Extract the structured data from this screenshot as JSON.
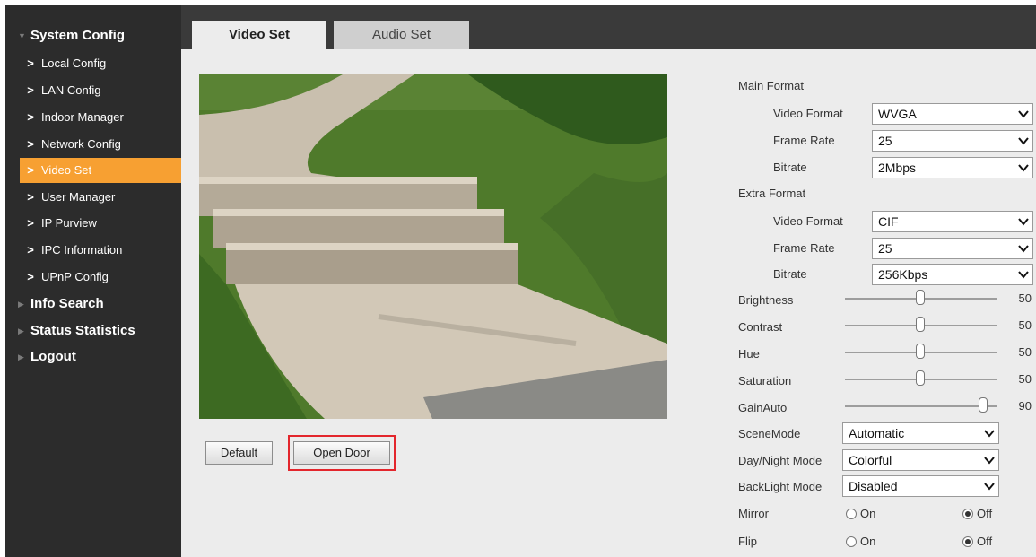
{
  "sidebar": {
    "system_config": "System Config",
    "items": [
      {
        "label": "Local Config"
      },
      {
        "label": "LAN Config"
      },
      {
        "label": "Indoor Manager"
      },
      {
        "label": "Network Config"
      },
      {
        "label": "Video Set",
        "active": true
      },
      {
        "label": "User Manager"
      },
      {
        "label": "IP Purview"
      },
      {
        "label": "IPC Information"
      },
      {
        "label": "UPnP Config"
      }
    ],
    "info_search": "Info Search",
    "status_statistics": "Status Statistics",
    "logout": "Logout"
  },
  "tabs": {
    "video_set": "Video Set",
    "audio_set": "Audio Set"
  },
  "buttons": {
    "default": "Default",
    "open_door": "Open Door"
  },
  "settings": {
    "main_format": "Main Format",
    "extra_format": "Extra Format",
    "main": {
      "video_format": {
        "label": "Video Format",
        "value": "WVGA"
      },
      "frame_rate": {
        "label": "Frame Rate",
        "value": "25"
      },
      "bitrate": {
        "label": "Bitrate",
        "value": "2Mbps"
      }
    },
    "extra": {
      "video_format": {
        "label": "Video Format",
        "value": "CIF"
      },
      "frame_rate": {
        "label": "Frame Rate",
        "value": "25"
      },
      "bitrate": {
        "label": "Bitrate",
        "value": "256Kbps"
      }
    },
    "sliders": {
      "brightness": {
        "label": "Brightness",
        "value": "50"
      },
      "contrast": {
        "label": "Contrast",
        "value": "50"
      },
      "hue": {
        "label": "Hue",
        "value": "50"
      },
      "saturation": {
        "label": "Saturation",
        "value": "50"
      },
      "gain_auto": {
        "label": "GainAuto",
        "value": "90"
      }
    },
    "scene_mode": {
      "label": "SceneMode",
      "value": "Automatic"
    },
    "day_night_mode": {
      "label": "Day/Night Mode",
      "value": "Colorful"
    },
    "backlight_mode": {
      "label": "BackLight Mode",
      "value": "Disabled"
    },
    "mirror": {
      "label": "Mirror",
      "on": "On",
      "off": "Off",
      "selected": "Off"
    },
    "flip": {
      "label": "Flip",
      "on": "On",
      "off": "Off",
      "selected": "Off"
    }
  },
  "colors": {
    "accent": "#f7a032",
    "sidebar_bg": "#2c2c2c",
    "highlight": "#e3262c"
  }
}
